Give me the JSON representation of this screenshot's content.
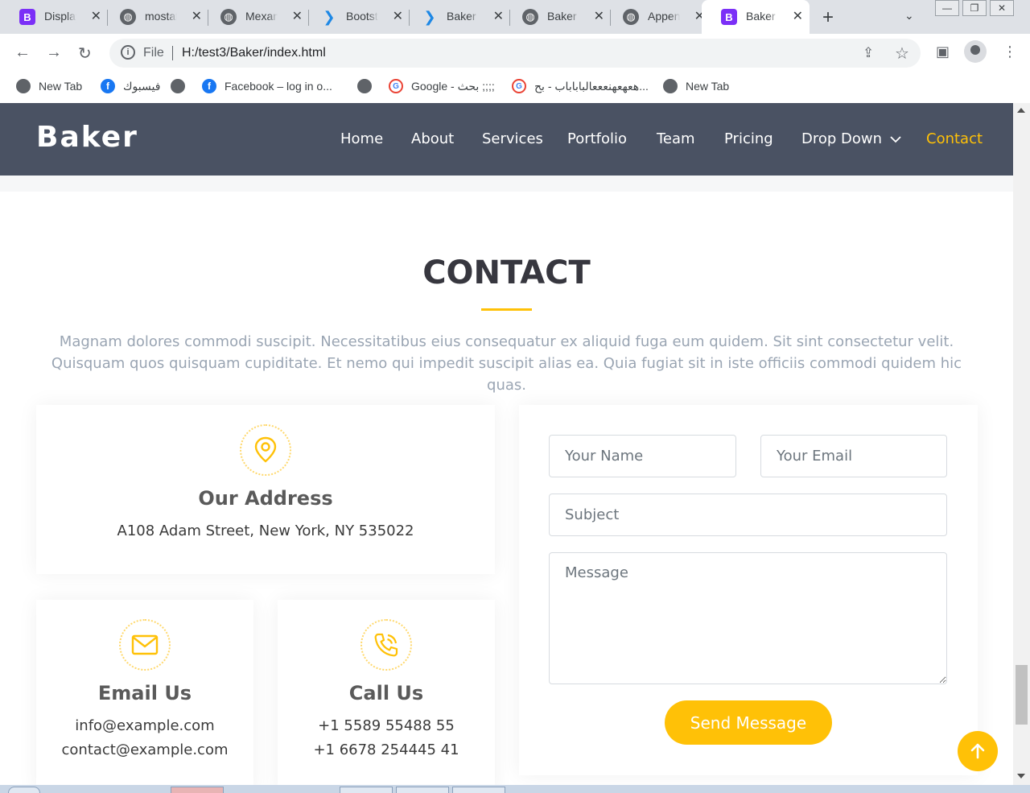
{
  "browser": {
    "tabs": [
      {
        "label": "Display",
        "icon": "bootstrap-icon"
      },
      {
        "label": "mostaf",
        "icon": "globe-icon"
      },
      {
        "label": "Mexan",
        "icon": "globe-icon"
      },
      {
        "label": "Bootst",
        "icon": "tailwind-icon"
      },
      {
        "label": "Baker",
        "icon": "tailwind-icon"
      },
      {
        "label": "Baker",
        "icon": "globe-icon"
      },
      {
        "label": "Appen",
        "icon": "globe-icon"
      },
      {
        "label": "Baker",
        "icon": "bootstrap-icon"
      }
    ],
    "address": {
      "scheme": "File",
      "url": "H:/test3/Baker/index.html"
    },
    "bookmarks": [
      {
        "label": "New Tab",
        "icon": "globe-icon"
      },
      {
        "label": "فيسبوك",
        "icon": "facebook-icon"
      },
      {
        "label": "",
        "icon": "globe-icon"
      },
      {
        "label": "Facebook – log in o...",
        "icon": "facebook-icon"
      },
      {
        "label": "",
        "icon": "globe-icon"
      },
      {
        "label": "Google - بحث ;;;;",
        "icon": "google-icon"
      },
      {
        "label": "هعهعهنعععالباباباب - بح...",
        "icon": "google-icon"
      },
      {
        "label": "New Tab",
        "icon": "globe-icon"
      }
    ]
  },
  "site": {
    "brand": "Baker",
    "nav": [
      "Home",
      "About",
      "Services",
      "Portfolio",
      "Team",
      "Pricing",
      "Drop Down",
      "Contact"
    ],
    "active_nav": "Contact",
    "accent_color": "#ffc107",
    "header_color": "#4a5263",
    "contact": {
      "title": "CONTACT",
      "description": "Magnam dolores commodi suscipit. Necessitatibus eius consequatur ex aliquid fuga eum quidem. Sit sint consectetur velit. Quisquam quos quisquam cupiditate. Et nemo qui impedit suscipit alias ea. Quia fugiat sit in iste officiis commodi quidem hic quas.",
      "address": {
        "title": "Our Address",
        "text": "A108 Adam Street, New York, NY 535022"
      },
      "email": {
        "title": "Email Us",
        "lines": [
          "info@example.com",
          "contact@example.com"
        ]
      },
      "phone": {
        "title": "Call Us",
        "lines": [
          "+1 5589 55488 55",
          "+1 6678 254445 41"
        ]
      },
      "form": {
        "name_placeholder": "Your Name",
        "email_placeholder": "Your Email",
        "subject_placeholder": "Subject",
        "message_placeholder": "Message",
        "submit_label": "Send Message"
      }
    }
  }
}
